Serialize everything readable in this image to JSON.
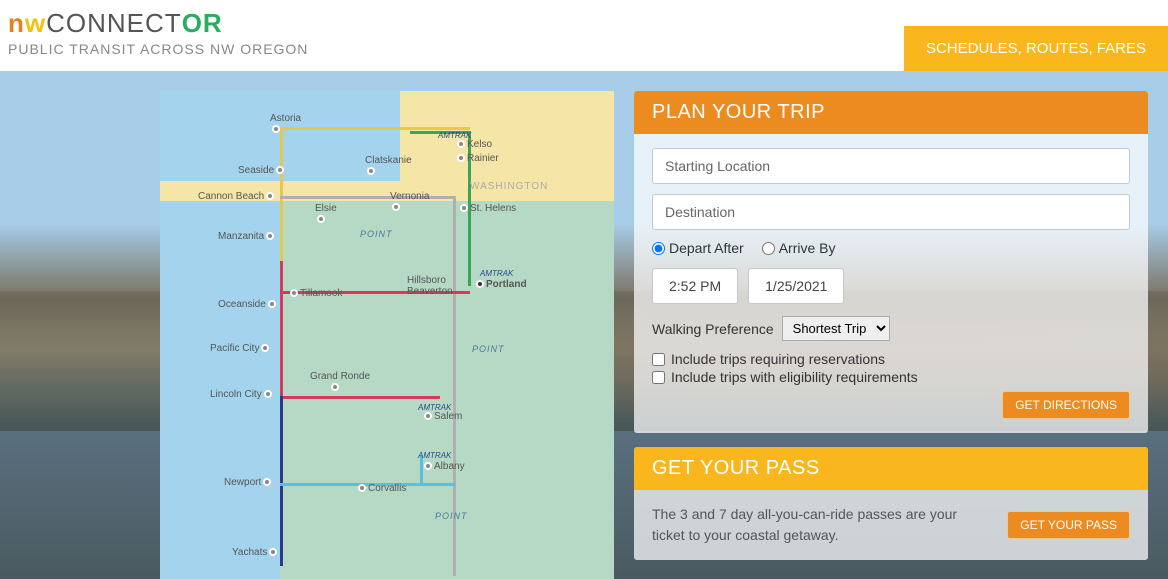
{
  "header": {
    "logo_nw": "nw",
    "logo_connect": "CONNECT",
    "logo_or": "OR",
    "tagline": "PUBLIC TRANSIT ACROSS NW OREGON",
    "nav_button": "SCHEDULES, ROUTES, FARES"
  },
  "map": {
    "washington_label": "WASHINGTON",
    "point_labels": [
      "POINT",
      "POINT",
      "POINT"
    ],
    "amtrak_labels": [
      "AMTRAK",
      "AMTRAK",
      "AMTRAK",
      "AMTRAK"
    ],
    "cities": {
      "astoria": "Astoria",
      "kelso": "Kelso",
      "rainier": "Rainier",
      "clatskanie": "Clatskanie",
      "seaside": "Seaside",
      "cannon_beach": "Cannon Beach",
      "elsie": "Elsie",
      "vernonia": "Vernonia",
      "st_helens": "St. Helens",
      "manzanita": "Manzanita",
      "tillamook": "Tillamook",
      "hillsboro": "Hillsboro",
      "beaverton": "Beaverton",
      "portland": "Portland",
      "oceanside": "Oceanside",
      "pacific_city": "Pacific City",
      "grand_ronde": "Grand Ronde",
      "lincoln_city": "Lincoln City",
      "salem": "Salem",
      "albany": "Albany",
      "newport": "Newport",
      "corvallis": "Corvallis",
      "yachats": "Yachats"
    }
  },
  "plan": {
    "title": "PLAN YOUR TRIP",
    "start_placeholder": "Starting Location",
    "dest_placeholder": "Destination",
    "depart_label": "Depart After",
    "arrive_label": "Arrive By",
    "time_value": "2:52 PM",
    "date_value": "1/25/2021",
    "walking_label": "Walking Preference",
    "walking_options": [
      "Shortest Trip"
    ],
    "include_reservations": "Include trips requiring reservations",
    "include_eligibility": "Include trips with eligibility requirements",
    "get_directions": "GET DIRECTIONS"
  },
  "pass": {
    "title": "GET YOUR PASS",
    "text": "The 3 and 7 day all-you-can-ride passes are your ticket to your coastal getaway.",
    "button": "GET YOUR PASS"
  }
}
